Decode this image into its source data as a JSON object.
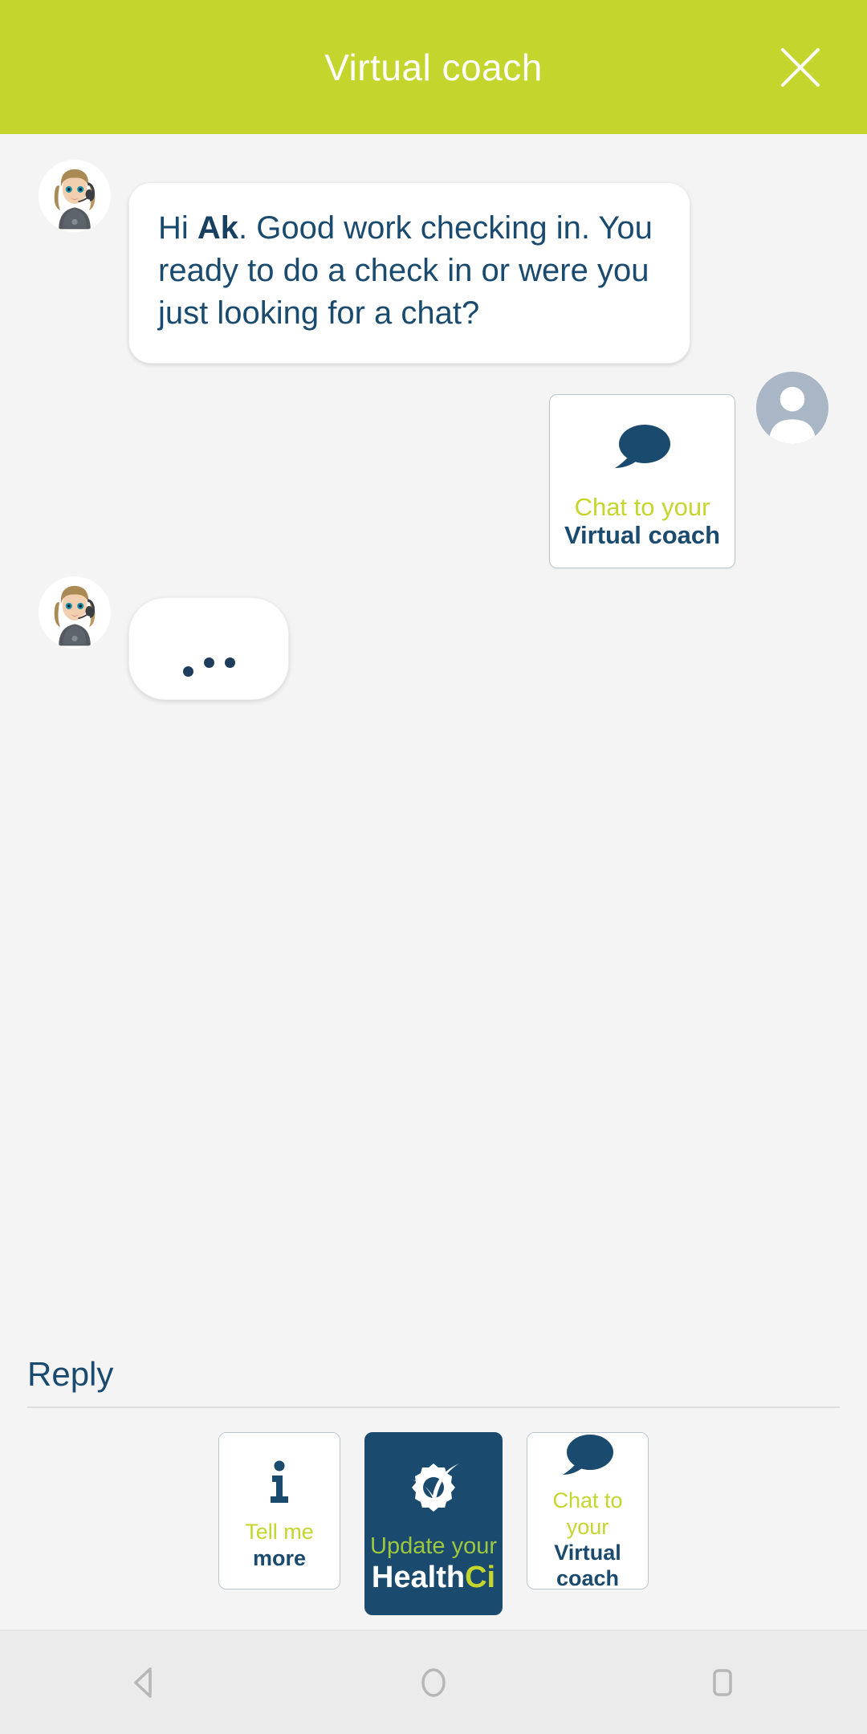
{
  "header": {
    "title": "Virtual coach",
    "close_icon": "close-icon",
    "background_color": "#c4d62e",
    "title_color": "#ffffff"
  },
  "colors": {
    "brand_green": "#c4d62e",
    "brand_navy": "#1a4a6e",
    "page_background": "#f4f4f4",
    "bubble_background": "#ffffff"
  },
  "conversation": [
    {
      "sender": "coach",
      "avatar_icon": "coach-avatar-icon",
      "type": "text",
      "text_before_bold": "Hi ",
      "bold_text": "Ak",
      "text_after_bold": ". Good work checking in. You ready to do a check in or were you just looking for a chat?"
    },
    {
      "sender": "user",
      "avatar_icon": "user-avatar-icon",
      "type": "card",
      "icon": "speech-bubble-icon",
      "line1": "Chat to your",
      "line2": "Virtual coach"
    },
    {
      "sender": "coach",
      "avatar_icon": "coach-avatar-icon",
      "type": "typing",
      "dots": 3
    }
  ],
  "reply": {
    "label": "Reply",
    "options": [
      {
        "id": "tell-me-more",
        "icon": "info-icon",
        "line1": "Tell me",
        "line2": "more",
        "style": "light"
      },
      {
        "id": "update-healthci",
        "icon": "gear-check-icon",
        "line1": "Update your",
        "line2": "Health",
        "line2_accent": "Ci",
        "style": "dark"
      },
      {
        "id": "chat-virtual-coach",
        "icon": "speech-bubble-icon",
        "line1": "Chat to your",
        "line2": "Virtual coach",
        "style": "light"
      }
    ]
  },
  "navbar": {
    "back": "back-triangle-icon",
    "home": "home-circle-icon",
    "recents": "recents-square-icon"
  }
}
